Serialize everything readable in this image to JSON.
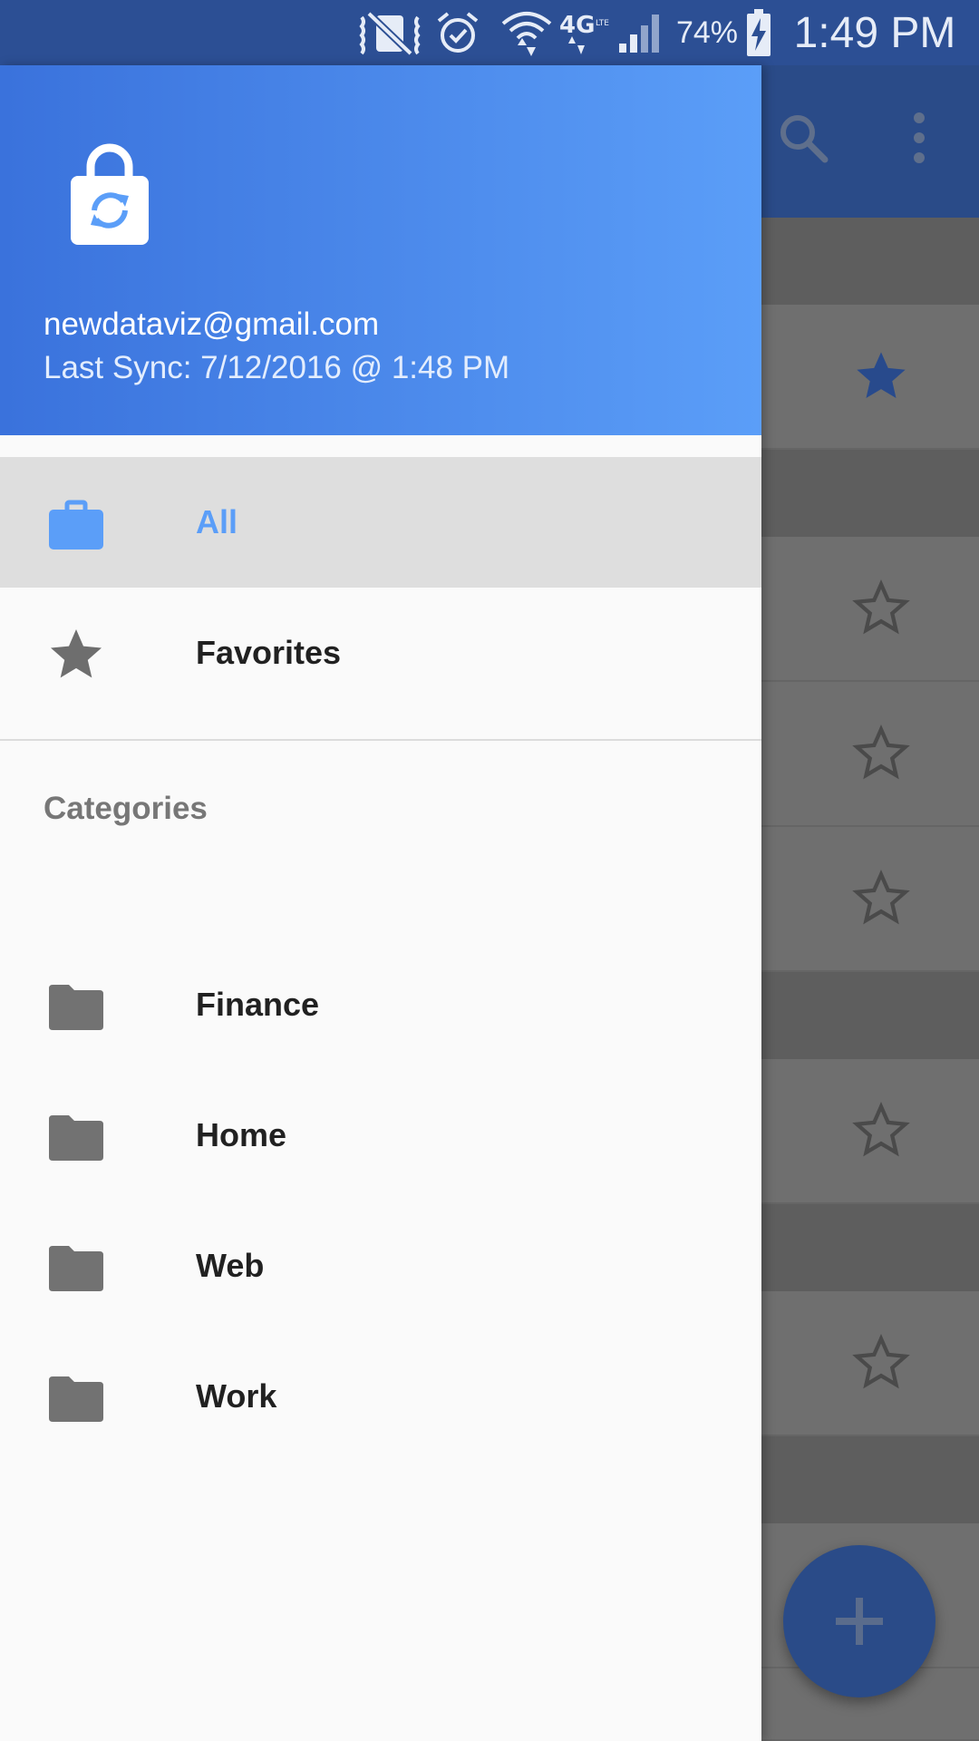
{
  "status_bar": {
    "battery_percent": "74%",
    "time": "1:49 PM",
    "icons": [
      "mute-icon",
      "alarm-icon",
      "wifi-icon",
      "4g-lte-icon",
      "signal-icon",
      "battery-charging-icon"
    ]
  },
  "app_toolbar": {
    "icons": [
      "search-icon",
      "overflow-menu-icon"
    ],
    "color": "#2a4b88"
  },
  "background_list": {
    "favorite_states": [
      true,
      false,
      false,
      false,
      false,
      false
    ]
  },
  "fab": {
    "icon": "plus-icon"
  },
  "drawer": {
    "header": {
      "logo_icon": "lock-sync-icon",
      "email": "newdataviz@gmail.com",
      "last_sync": "Last Sync: 7/12/2016 @ 1:48 PM",
      "gradient": [
        "#3a72dc",
        "#5b9ef8"
      ]
    },
    "nav": [
      {
        "label": "All",
        "icon": "briefcase-icon",
        "active": true
      },
      {
        "label": "Favorites",
        "icon": "star-icon",
        "active": false
      }
    ],
    "categories": {
      "heading": "Categories",
      "items": [
        {
          "label": "Finance",
          "icon": "folder-icon"
        },
        {
          "label": "Home",
          "icon": "folder-icon"
        },
        {
          "label": "Web",
          "icon": "folder-icon"
        },
        {
          "label": "Work",
          "icon": "folder-icon"
        }
      ]
    },
    "accent_color": "#5b9ef8"
  }
}
